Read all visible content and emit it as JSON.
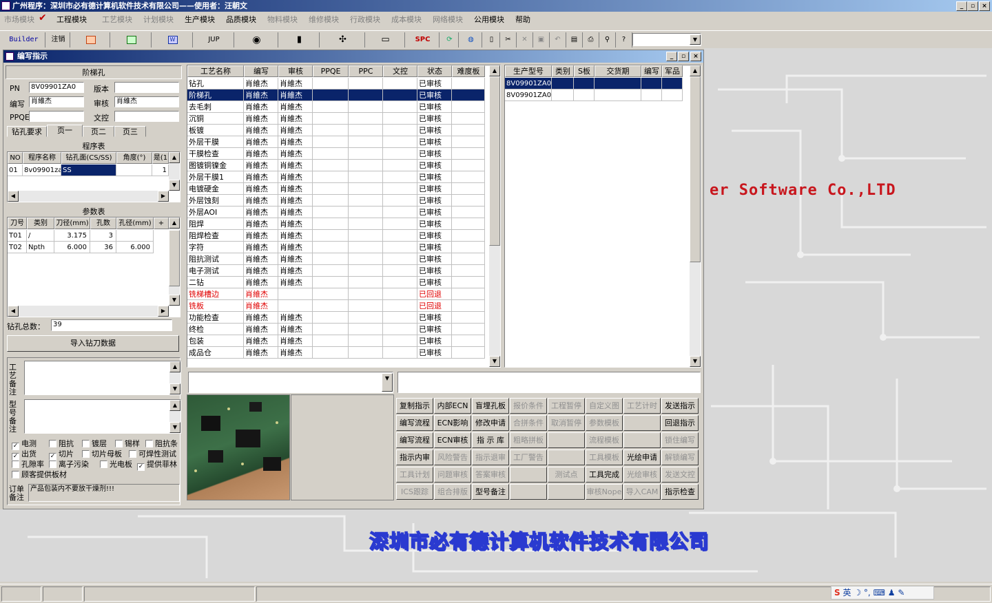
{
  "app": {
    "title": "广州程序：深圳市必有德计算机软件技术有限公司——使用者：汪朝文"
  },
  "menus": [
    {
      "label": "市场模块",
      "enabled": false
    },
    {
      "label": "工程模块",
      "enabled": true,
      "checked": true
    },
    {
      "label": "工艺模块",
      "enabled": false
    },
    {
      "label": "计划模块",
      "enabled": false
    },
    {
      "label": "生产模块",
      "enabled": true
    },
    {
      "label": "品质模块",
      "enabled": true
    },
    {
      "label": "物料模块",
      "enabled": false
    },
    {
      "label": "维修模块",
      "enabled": false
    },
    {
      "label": "行政模块",
      "enabled": false
    },
    {
      "label": "成本模块",
      "enabled": false
    },
    {
      "label": "网络模块",
      "enabled": false
    },
    {
      "label": "公用模块",
      "enabled": true
    },
    {
      "label": "帮助",
      "enabled": true
    }
  ],
  "toolbar": {
    "builder": "Builder",
    "logout": "注销",
    "jup": "JUP",
    "spc": "SPC"
  },
  "window": {
    "title": "编写指示"
  },
  "left": {
    "process_title": "阶梯孔",
    "pn_label": "PN",
    "pn_value": "8V09901ZA0",
    "version_label": "版本",
    "version_value": "",
    "author_label": "编写",
    "author_value": "肖維杰",
    "review_label": "审核",
    "review_value": "肖維杰",
    "ppqe_label": "PPQE",
    "ppqe_value": "",
    "wenkong_label": "文控",
    "wenkong_value": ""
  },
  "tabs": [
    "钻孔要求",
    "页一",
    "页二",
    "页三"
  ],
  "program_table": {
    "title": "程序表",
    "headers": [
      "NO",
      "程序名称",
      "钻孔面(CS/SS)",
      "角度(°)",
      "是(1"
    ],
    "rows": [
      [
        "01",
        "8v09901za",
        "SS",
        "",
        "1"
      ]
    ]
  },
  "param_table": {
    "title": "参数表",
    "headers": [
      "刀号",
      "类别",
      "刀径(mm)",
      "孔数",
      "孔径(mm)",
      "+"
    ],
    "rows": [
      [
        "T01",
        "/",
        "3.175",
        "3",
        ""
      ],
      [
        "T02",
        "Npth",
        "6.000",
        "36",
        "6.000"
      ]
    ]
  },
  "drill_total_label": "钻孔总数：",
  "drill_total_value": "39",
  "import_button": "导入钻刀数据",
  "process_note_label": "工艺备注",
  "model_note_label": "型号备注",
  "checkboxes": [
    {
      "label": "电测",
      "checked": true
    },
    {
      "label": "阻抗",
      "checked": false
    },
    {
      "label": "镀层",
      "checked": false
    },
    {
      "label": "锡样",
      "checked": false
    },
    {
      "label": "阻抗条",
      "checked": false
    },
    {
      "label": "出货",
      "checked": true
    },
    {
      "label": "切片",
      "checked": true
    },
    {
      "label": "切片母板",
      "checked": false
    },
    {
      "label": "可焊性测试",
      "checked": false
    },
    {
      "label": "孔隙率",
      "checked": false
    },
    {
      "label": "离子污染",
      "checked": false
    },
    {
      "label": "光电板",
      "checked": false
    },
    {
      "label": "提供菲林",
      "checked": true
    },
    {
      "label": "顾客提供板材",
      "checked": false
    }
  ],
  "order_note_label": "订单备注",
  "order_note_value": "产品包装内不要放干燥剂!!!",
  "process_grid": {
    "headers": [
      "工艺名称",
      "编写",
      "审核",
      "PPQE",
      "PPC",
      "文控",
      "状态",
      "难度板"
    ],
    "rows": [
      {
        "name": "钻孔",
        "author": "肖維杰",
        "review": "肖維杰",
        "status": "已审核"
      },
      {
        "name": "阶梯孔",
        "author": "肖維杰",
        "review": "肖維杰",
        "status": "已审核",
        "selected": true
      },
      {
        "name": "去毛刺",
        "author": "肖維杰",
        "review": "肖維杰",
        "status": "已审核"
      },
      {
        "name": "沉铜",
        "author": "肖維杰",
        "review": "肖維杰",
        "status": "已审核"
      },
      {
        "name": "板镀",
        "author": "肖維杰",
        "review": "肖維杰",
        "status": "已审核"
      },
      {
        "name": "外层干膜",
        "author": "肖維杰",
        "review": "肖維杰",
        "status": "已审核"
      },
      {
        "name": "干膜检查",
        "author": "肖維杰",
        "review": "肖維杰",
        "status": "已审核"
      },
      {
        "name": "图镀铜镍金",
        "author": "肖維杰",
        "review": "肖維杰",
        "status": "已审核"
      },
      {
        "name": "外层干膜1",
        "author": "肖維杰",
        "review": "肖維杰",
        "status": "已审核"
      },
      {
        "name": "电镀硬金",
        "author": "肖維杰",
        "review": "肖維杰",
        "status": "已审核"
      },
      {
        "name": "外层蚀刻",
        "author": "肖維杰",
        "review": "肖維杰",
        "status": "已审核"
      },
      {
        "name": "外层AOI",
        "author": "肖維杰",
        "review": "肖維杰",
        "status": "已审核"
      },
      {
        "name": "阻焊",
        "author": "肖維杰",
        "review": "肖維杰",
        "status": "已审核"
      },
      {
        "name": "阻焊检查",
        "author": "肖維杰",
        "review": "肖維杰",
        "status": "已审核"
      },
      {
        "name": "字符",
        "author": "肖維杰",
        "review": "肖維杰",
        "status": "已审核"
      },
      {
        "name": "阻抗测试",
        "author": "肖維杰",
        "review": "肖維杰",
        "status": "已审核"
      },
      {
        "name": "电子测试",
        "author": "肖維杰",
        "review": "肖維杰",
        "status": "已审核"
      },
      {
        "name": "二钻",
        "author": "肖維杰",
        "review": "肖維杰",
        "status": "已审核"
      },
      {
        "name": "铣梯槽边",
        "author": "肖維杰",
        "review": "",
        "status": "已回退",
        "red": true
      },
      {
        "name": "铣板",
        "author": "肖維杰",
        "review": "",
        "status": "已回退",
        "red": true
      },
      {
        "name": "功能检查",
        "author": "肖維杰",
        "review": "肖維杰",
        "status": "已审核"
      },
      {
        "name": "终检",
        "author": "肖維杰",
        "review": "肖維杰",
        "status": "已审核"
      },
      {
        "name": "包装",
        "author": "肖維杰",
        "review": "肖維杰",
        "status": "已审核"
      },
      {
        "name": "成品仓",
        "author": "肖維杰",
        "review": "肖維杰",
        "status": "已审核"
      }
    ]
  },
  "model_grid": {
    "headers": [
      "生产型号",
      "类别",
      "S板",
      "交货期",
      "编写",
      "军品"
    ],
    "rows": [
      {
        "model": "8V09901ZA0",
        "selected": true
      },
      {
        "model": "8V09901ZA0"
      }
    ]
  },
  "buttons": [
    [
      {
        "label": "复制指示",
        "enabled": true
      },
      {
        "label": "内部ECN",
        "enabled": true
      },
      {
        "label": "盲埋孔板",
        "enabled": true
      },
      {
        "label": "报价条件",
        "enabled": false
      },
      {
        "label": "工程暂停",
        "enabled": false
      },
      {
        "label": "自定义图",
        "enabled": false
      },
      {
        "label": "工艺计时",
        "enabled": false
      },
      {
        "label": "发送指示",
        "enabled": true
      }
    ],
    [
      {
        "label": "编写流程",
        "enabled": true
      },
      {
        "label": "ECN影响",
        "enabled": true
      },
      {
        "label": "修改申请",
        "enabled": true
      },
      {
        "label": "合拼条件",
        "enabled": false
      },
      {
        "label": "取消暂停",
        "enabled": false
      },
      {
        "label": "参数模板",
        "enabled": false
      },
      {
        "label": "",
        "enabled": false
      },
      {
        "label": "回退指示",
        "enabled": true
      }
    ],
    [
      {
        "label": "编写流程",
        "enabled": true
      },
      {
        "label": "ECN审核",
        "enabled": true
      },
      {
        "label": "指 示 库",
        "enabled": true
      },
      {
        "label": "粗略拼板",
        "enabled": false
      },
      {
        "label": "",
        "enabled": false
      },
      {
        "label": "流程模板",
        "enabled": false
      },
      {
        "label": "",
        "enabled": false
      },
      {
        "label": "锁住编写",
        "enabled": false
      }
    ],
    [
      {
        "label": "指示内审",
        "enabled": true
      },
      {
        "label": "风险警告",
        "enabled": false
      },
      {
        "label": "指示退审",
        "enabled": false
      },
      {
        "label": "工厂警告",
        "enabled": false
      },
      {
        "label": "",
        "enabled": false
      },
      {
        "label": "工具模板",
        "enabled": false
      },
      {
        "label": "光绘申请",
        "enabled": true
      },
      {
        "label": "解锁编写",
        "enabled": false
      }
    ],
    [
      {
        "label": "工具计划",
        "enabled": false
      },
      {
        "label": "问题审核",
        "enabled": false
      },
      {
        "label": "答案审核",
        "enabled": false
      },
      {
        "label": "",
        "enabled": false
      },
      {
        "label": "测试点",
        "enabled": false
      },
      {
        "label": "工具完成",
        "enabled": true
      },
      {
        "label": "光绘审核",
        "enabled": false
      },
      {
        "label": "发送文控",
        "enabled": false
      }
    ],
    [
      {
        "label": "ICS跟踪",
        "enabled": false
      },
      {
        "label": "组合排版",
        "enabled": false
      },
      {
        "label": "型号备注",
        "enabled": true
      },
      {
        "label": "",
        "enabled": false
      },
      {
        "label": "",
        "enabled": false
      },
      {
        "label": "审核Nope",
        "enabled": false
      },
      {
        "label": "导入CAM",
        "enabled": false
      },
      {
        "label": "指示检查",
        "enabled": true
      }
    ]
  ],
  "background": {
    "software_text": "er  Software  Co.,LTD",
    "company_text": "深圳市必有德计算机软件技术有限公司"
  },
  "tray": {
    "ime": "英"
  }
}
